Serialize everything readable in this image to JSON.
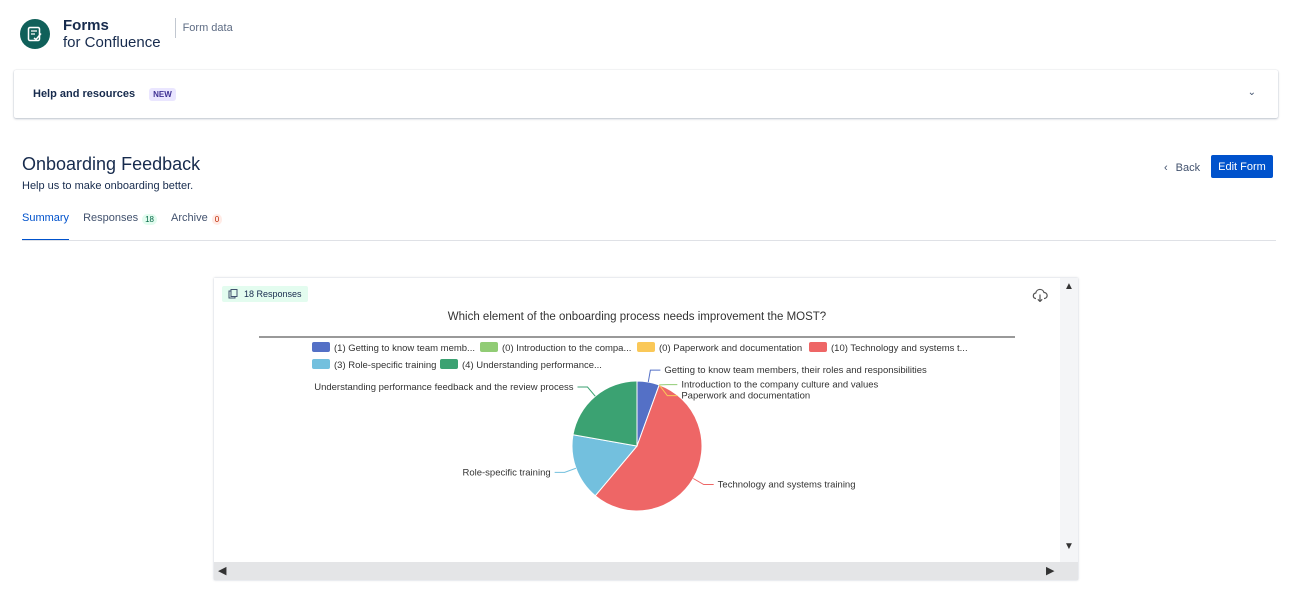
{
  "header": {
    "brand_name": "Forms",
    "brand_sub": "for Confluence",
    "context": "Form data"
  },
  "help": {
    "title": "Help and resources",
    "badge": "NEW"
  },
  "page": {
    "title": "Onboarding Feedback",
    "description": "Help us to make onboarding better.",
    "back_label": "Back",
    "edit_label": "Edit Form"
  },
  "tabs": [
    {
      "label": "Summary",
      "count": ""
    },
    {
      "label": "Responses",
      "count": "18"
    },
    {
      "label": "Archive",
      "count": "0"
    }
  ],
  "card": {
    "responses_badge": "18 Responses"
  },
  "colors": {
    "primary": "#0052cc",
    "logo": "#10605a"
  },
  "chart_data": {
    "type": "pie",
    "title": "Which element of the onboarding process needs improvement the MOST?",
    "legend_position": "top",
    "legend": [
      "(1) Getting to know team memb...",
      "(0) Introduction to the compa...",
      "(0) Paperwork and documentation",
      "(10) Technology and systems t...",
      "(3) Role-specific training",
      "(4) Understanding performance..."
    ],
    "slices": [
      {
        "label": "Getting to know team members, their roles and responsibilities",
        "value": 1,
        "color": "#5470c6"
      },
      {
        "label": "Introduction to the company culture and values",
        "value": 0,
        "color": "#91cc75"
      },
      {
        "label": "Paperwork and documentation",
        "value": 0,
        "color": "#fac858"
      },
      {
        "label": "Technology and systems training",
        "value": 10,
        "color": "#ee6666"
      },
      {
        "label": "Role-specific training",
        "value": 3,
        "color": "#73c0de"
      },
      {
        "label": "Understanding performance feedback and the review process",
        "value": 4,
        "color": "#3ba272"
      }
    ]
  }
}
